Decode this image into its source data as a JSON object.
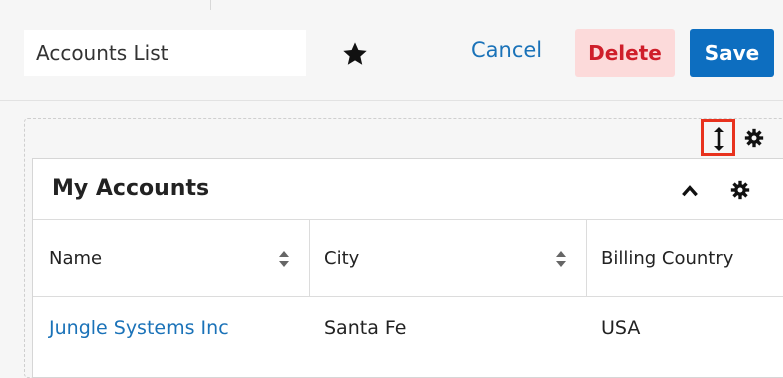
{
  "header": {
    "title_value": "Accounts List",
    "favorite_icon": "star-icon",
    "cancel_label": "Cancel",
    "delete_label": "Delete",
    "save_label": "Save",
    "colors": {
      "link": "#1a72b8",
      "delete_bg": "#fcdada",
      "delete_text": "#cf1e2a",
      "save_bg": "#0d6ec0",
      "highlight": "#e8321e"
    }
  },
  "dashlet_area": {
    "resize_icon": "resize-vertical-icon",
    "settings_icon": "gear-icon"
  },
  "dashlet": {
    "title": "My Accounts",
    "collapse_icon": "chevron-up-icon",
    "settings_icon": "gear-icon",
    "columns": [
      {
        "label": "Name",
        "sortable": true
      },
      {
        "label": "City",
        "sortable": true
      },
      {
        "label": "Billing Country",
        "sortable": false
      }
    ],
    "rows": [
      {
        "name": "Jungle Systems Inc",
        "city": "Santa Fe",
        "country": "USA"
      }
    ]
  }
}
